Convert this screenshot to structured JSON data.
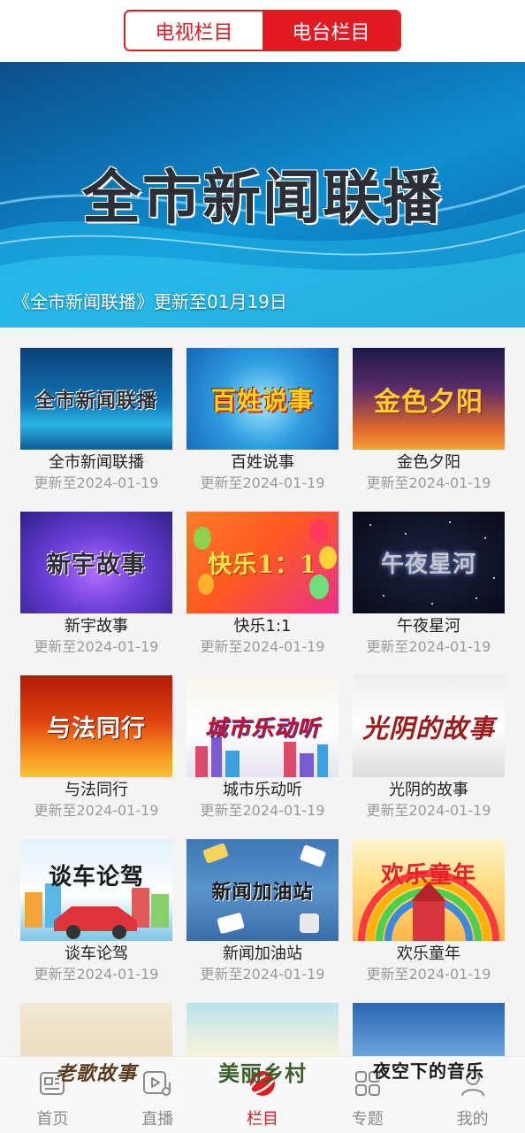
{
  "tabs": {
    "tv": "电视栏目",
    "radio": "电台栏目",
    "active": "radio"
  },
  "banner": {
    "title": "全市新闻联播",
    "caption": "《全市新闻联播》更新至01月19日"
  },
  "programs": [
    {
      "thumb_text": "全市新闻联播",
      "name": "全市新闻联播",
      "updated": "更新至2024-01-19"
    },
    {
      "thumb_text": "百姓说事",
      "name": "百姓说事",
      "updated": "更新至2024-01-19"
    },
    {
      "thumb_text": "金色夕阳",
      "name": "金色夕阳",
      "updated": "更新至2024-01-19"
    },
    {
      "thumb_text": "新宇故事",
      "name": "新宇故事",
      "updated": "更新至2024-01-19"
    },
    {
      "thumb_text": "快乐1：1",
      "name": "快乐1:1",
      "updated": "更新至2024-01-19"
    },
    {
      "thumb_text": "午夜星河",
      "name": "午夜星河",
      "updated": "更新至2024-01-19"
    },
    {
      "thumb_text": "与法同行",
      "name": "与法同行",
      "updated": "更新至2024-01-19"
    },
    {
      "thumb_text": "城市乐动听",
      "name": "城市乐动听",
      "updated": "更新至2024-01-19"
    },
    {
      "thumb_text": "光阴的故事",
      "name": "光阴的故事",
      "updated": "更新至2024-01-19"
    },
    {
      "thumb_text": "谈车论驾",
      "name": "谈车论驾",
      "updated": "更新至2024-01-19"
    },
    {
      "thumb_text": "新闻加油站",
      "name": "新闻加油站",
      "updated": "更新至2024-01-19"
    },
    {
      "thumb_text": "欢乐童年",
      "name": "欢乐童年",
      "updated": "更新至2024-01-19"
    },
    {
      "thumb_text": "老歌故事",
      "name": "",
      "updated": ""
    },
    {
      "thumb_text": "美丽乡村",
      "name": "",
      "updated": ""
    },
    {
      "thumb_text": "夜空下的音乐",
      "name": "",
      "updated": ""
    }
  ],
  "nav": [
    {
      "label": "首页",
      "icon": "news-icon"
    },
    {
      "label": "直播",
      "icon": "live-play-icon"
    },
    {
      "label": "栏目",
      "icon": "column-planet-icon",
      "active": true
    },
    {
      "label": "专题",
      "icon": "grid-icon"
    },
    {
      "label": "我的",
      "icon": "user-icon"
    }
  ],
  "colors": {
    "accent": "#e21b23",
    "nav_inactive": "#8a8a8a",
    "meta_text": "#9a9a9a"
  }
}
